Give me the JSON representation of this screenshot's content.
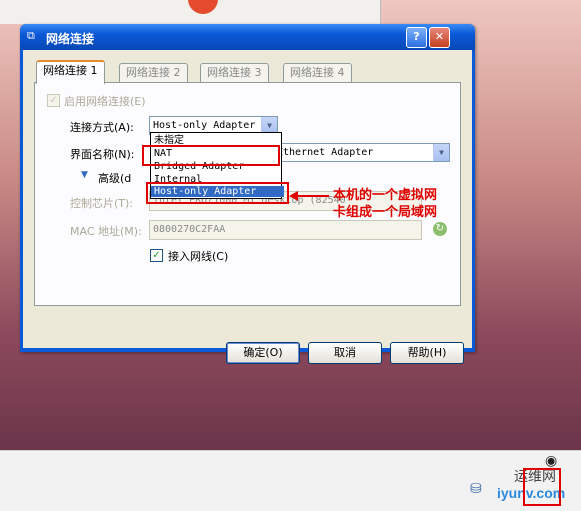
{
  "dialog": {
    "title": "网络连接",
    "help_glyph": "?",
    "close_glyph": "✕",
    "tabs": [
      {
        "label": "网络连接 1"
      },
      {
        "label": "网络连接 2"
      },
      {
        "label": "网络连接 3"
      },
      {
        "label": "网络连接 4"
      }
    ],
    "enable_checkbox_label": "启用网络连接(E)",
    "attach_label": "连接方式(A):",
    "attach_value": "Host-only Adapter",
    "attach_options": [
      "未指定",
      "NAT",
      "Bridged Adapter",
      "Internal",
      "Host-only Adapter"
    ],
    "interface_label": "界面名称(N):",
    "interface_value": "Ethernet Adapter",
    "advanced_label": "高级(d",
    "chip_label": "控制芯片(T):",
    "chip_value": "Intel PRO/1000 MT Desktop (82540",
    "mac_label": "MAC 地址(M):",
    "mac_value": "0800270C2FAA",
    "cable_label": "接入网线(C)",
    "ok_label": "确定(O)",
    "cancel_label": "取消",
    "help_label": "帮助(H)"
  },
  "annotation": {
    "line1": "本机的一个虚拟网",
    "line2": "卡组成一个局域网",
    "color": "#e00000"
  },
  "watermark": {
    "text1": "运维网",
    "text2": "iyunv.com"
  },
  "colors": {
    "titlebar": "#0a58d6",
    "selection": "#316ac5",
    "annotation_red": "#e00000"
  }
}
